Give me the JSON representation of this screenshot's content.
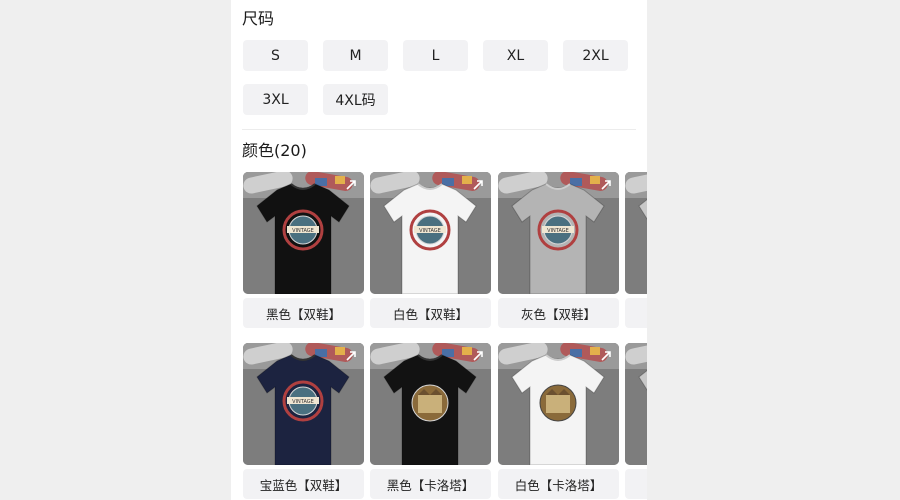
{
  "size_section": {
    "title": "尺码",
    "options": [
      "S",
      "M",
      "L",
      "XL",
      "2XL",
      "3XL",
      "4XL码"
    ]
  },
  "color_section": {
    "title": "颜色(20)",
    "items": [
      {
        "label": "黑色【双鞋】",
        "shirt_color": "#111111",
        "print": "vintage"
      },
      {
        "label": "白色【双鞋】",
        "shirt_color": "#f4f4f4",
        "print": "vintage"
      },
      {
        "label": "灰色【双鞋】",
        "shirt_color": "#b4b4b4",
        "print": "vintage"
      },
      {
        "label": "",
        "shirt_color": "#c8c8c8",
        "print": "vintage"
      },
      {
        "label": "宝蓝色【双鞋】",
        "shirt_color": "#1c2340",
        "print": "vintage"
      },
      {
        "label": "黑色【卡洛塔】",
        "shirt_color": "#121212",
        "print": "castle"
      },
      {
        "label": "白色【卡洛塔】",
        "shirt_color": "#f4f4f4",
        "print": "castle"
      },
      {
        "label": "",
        "shirt_color": "#c8c8c8",
        "print": "castle"
      }
    ],
    "print_text": "VINTAGE"
  },
  "icons": {
    "expand": "expand-icon"
  }
}
